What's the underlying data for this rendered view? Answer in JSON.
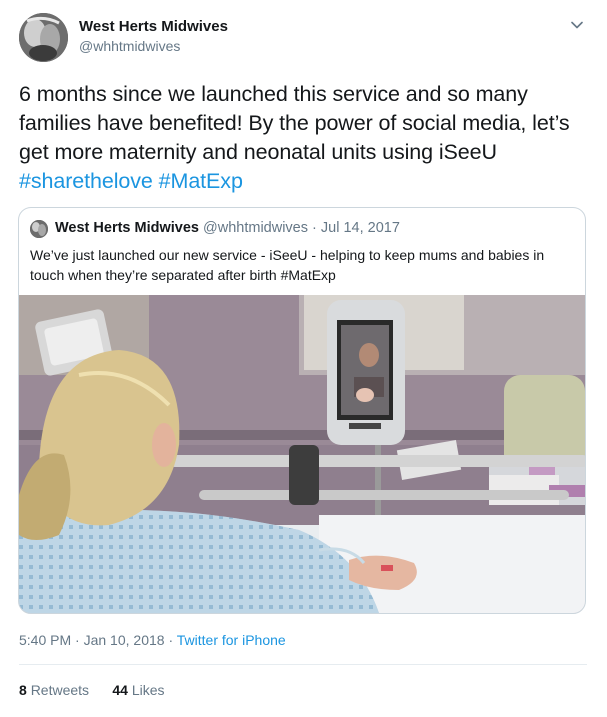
{
  "tweet": {
    "author": {
      "name": "West Herts Midwives",
      "handle": "@whhtmidwives"
    },
    "text_plain": "6 months since we launched this service and so many families have benefited! By the power of social media, let’s get more maternity and neonatal units using iSeeU",
    "hashtags": [
      "#sharethelove",
      "#MatExp"
    ],
    "quoted": {
      "name": "West Herts Midwives",
      "handle": "@whhtmidwives",
      "separator": "·",
      "date": "Jul 14, 2017",
      "text": "We’ve just launched our new service - iSeeU - helping to keep mums and babies in touch when they’re separated after birth #MatExp"
    },
    "meta": {
      "time": "5:40 PM",
      "separator": "·",
      "date": "Jan 10, 2018",
      "source": "Twitter for iPhone"
    },
    "stats": {
      "retweets_count": "8",
      "retweets_label": "Retweets",
      "likes_count": "44",
      "likes_label": "Likes"
    },
    "icons": {
      "caret": "chevron-down-icon"
    },
    "colors": {
      "link": "#1b95e0",
      "secondary_text": "#657786",
      "border": "#ccd6dd"
    }
  }
}
